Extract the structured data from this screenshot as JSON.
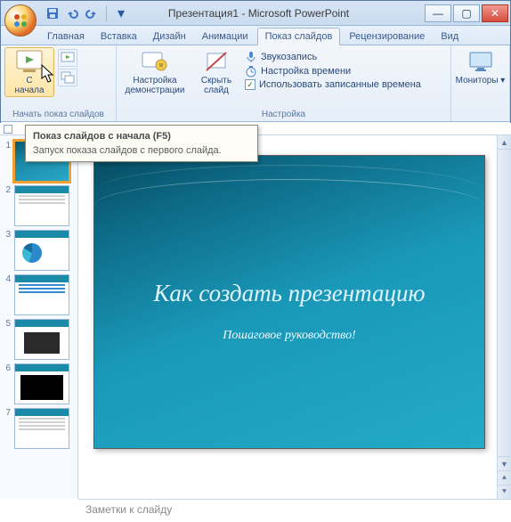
{
  "title": "Презентация1 - Microsoft PowerPoint",
  "tabs": {
    "home": "Главная",
    "insert": "Вставка",
    "design": "Дизайн",
    "animations": "Анимации",
    "slideshow": "Показ слайдов",
    "review": "Рецензирование",
    "view": "Вид"
  },
  "ribbon": {
    "start_group_title": "Начать показ слайдов",
    "from_begin": "С\nначала",
    "settings_group_title": "Настройка",
    "setup_show": "Настройка\nдемонстрации",
    "hide_slide": "Скрыть\nслайд",
    "record_narration": "Звукозапись",
    "rehearse": "Настройка времени",
    "use_timings": "Использовать записанные времена",
    "monitors_title": "",
    "monitors": "Мониторы"
  },
  "tooltip": {
    "title": "Показ слайдов с начала (F5)",
    "body": "Запуск показа слайдов с первого слайда."
  },
  "slide": {
    "title": "Как создать презентацию",
    "subtitle": "Пошаговое руководство!"
  },
  "thumbs": [
    "1",
    "2",
    "3",
    "4",
    "5",
    "6",
    "7"
  ],
  "notes_placeholder": "Заметки к слайду"
}
